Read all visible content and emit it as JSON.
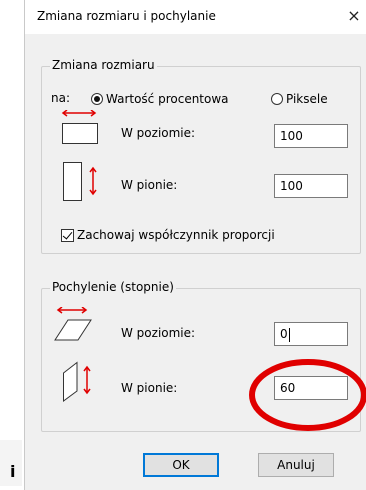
{
  "dialog": {
    "title": "Zmiana rozmiaru i pochylanie",
    "close_glyph": "×"
  },
  "resize": {
    "legend": "Zmiana rozmiaru",
    "by_label": "na:",
    "percent_option": "Wartość procentowa",
    "pixels_option": "Piksele",
    "selected_option": "Wartość procentowa",
    "horizontal_label": "W poziomie:",
    "horizontal_value": "100",
    "vertical_label": "W pionie:",
    "vertical_value": "100",
    "keep_ratio_label": "Zachowaj współczynnik proporcji",
    "keep_ratio_checked": true
  },
  "skew": {
    "legend": "Pochylenie (stopnie)",
    "horizontal_label": "W poziomie:",
    "horizontal_value": "0",
    "vertical_label": "W pionie:",
    "vertical_value": "60"
  },
  "buttons": {
    "ok": "OK",
    "cancel": "Anuluj"
  },
  "annotation": {
    "ring_color": "#e00000"
  },
  "background": {
    "stray_char": "i"
  },
  "colors": {
    "icon_red": "#e00000",
    "default_button_border": "#0078d7"
  }
}
